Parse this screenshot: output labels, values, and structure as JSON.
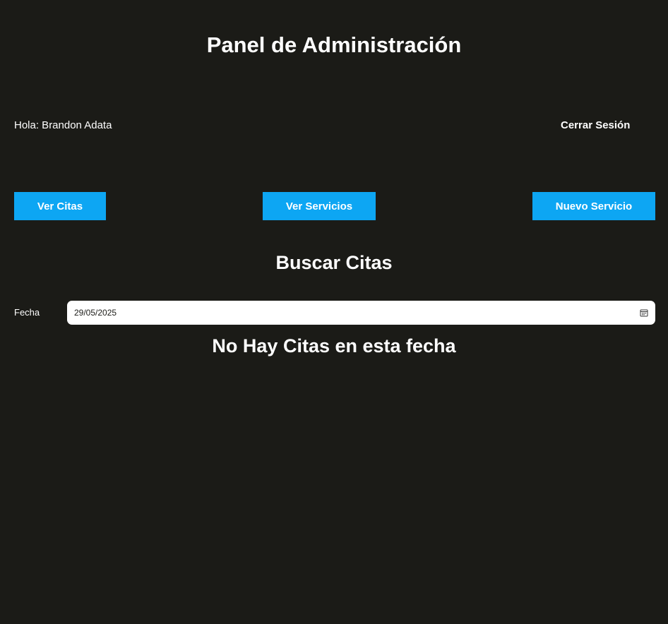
{
  "header": {
    "title": "Panel de Administración"
  },
  "user_bar": {
    "greeting": "Hola: Brandon Adata",
    "logout_label": "Cerrar Sesión"
  },
  "nav": {
    "ver_citas": "Ver Citas",
    "ver_servicios": "Ver Servicios",
    "nuevo_servicio": "Nuevo Servicio"
  },
  "search": {
    "title": "Buscar Citas",
    "date_label": "Fecha",
    "date_value": "29/05/2025",
    "calendar_icon": "calendar-icon"
  },
  "results": {
    "empty_message": "No Hay Citas en esta fecha"
  },
  "colors": {
    "background": "#1b1b17",
    "accent": "#0da6f3",
    "text": "#ffffff"
  }
}
